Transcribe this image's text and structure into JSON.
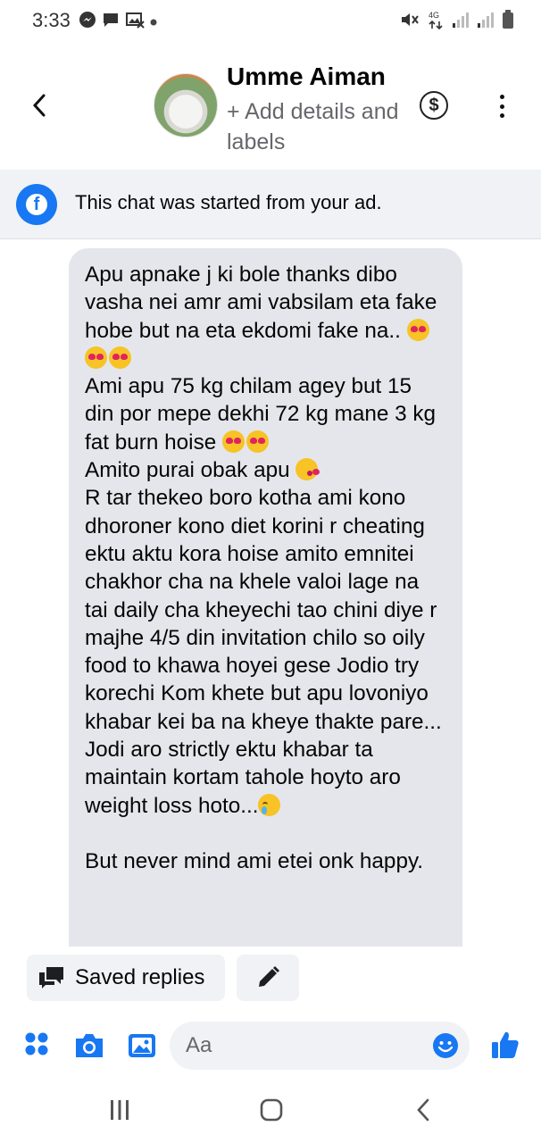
{
  "status_bar": {
    "time": "3:33",
    "left_icons": [
      "messenger-icon",
      "chat-bubble-icon",
      "image-off-icon",
      "dot-icon"
    ],
    "right_icons": [
      "mute-icon",
      "4g-signal-icon",
      "signal-bars-icon",
      "signal-bars-icon",
      "battery-icon"
    ],
    "network": "4G"
  },
  "header": {
    "contact_name": "Umme Aiman",
    "subtitle": "+ Add details and labels",
    "dollar_symbol": "$"
  },
  "ad_banner": {
    "text": "This chat was started from your ad."
  },
  "message": {
    "paragraphs": [
      "Apu apnake j ki bole thanks dibo vasha nei amr ami vabsilam eta fake hobe but na eta ekdomi fake na..",
      "Ami apu 75 kg chilam agey but 15 din por mepe dekhi 72 kg mane 3 kg fat burn hoise",
      "Amito purai obak apu",
      "R tar thekeo boro kotha ami kono dhoroner kono diet korini r cheating ektu aktu kora hoise amito emnitei chakhor cha na khele valoi lage na tai daily cha kheyechi tao chini diye r majhe 4/5 din invitation chilo so oily food to khawa hoyei gese Jodio try korechi Kom khete but apu lovoniyo khabar kei ba na kheye thakte pare...",
      "Jodi aro strictly ektu khabar ta maintain kortam tahole hoyto aro weight loss hoto...",
      "But never mind ami etei onk happy."
    ],
    "emojis": {
      "p0": [
        "heart-eyes",
        "heart-eyes",
        "heart-eyes"
      ],
      "p1": [
        "heart-eyes",
        "heart-eyes"
      ],
      "p2": [
        "kissing-heart"
      ],
      "p4": [
        "crying-smile"
      ]
    }
  },
  "quick_replies": {
    "saved_replies_label": "Saved replies"
  },
  "composer": {
    "placeholder": "Aa"
  },
  "colors": {
    "accent": "#1877f2",
    "bubble": "#e4e6eb",
    "banner": "#f0f2f5",
    "secondary_text": "#65676b"
  }
}
